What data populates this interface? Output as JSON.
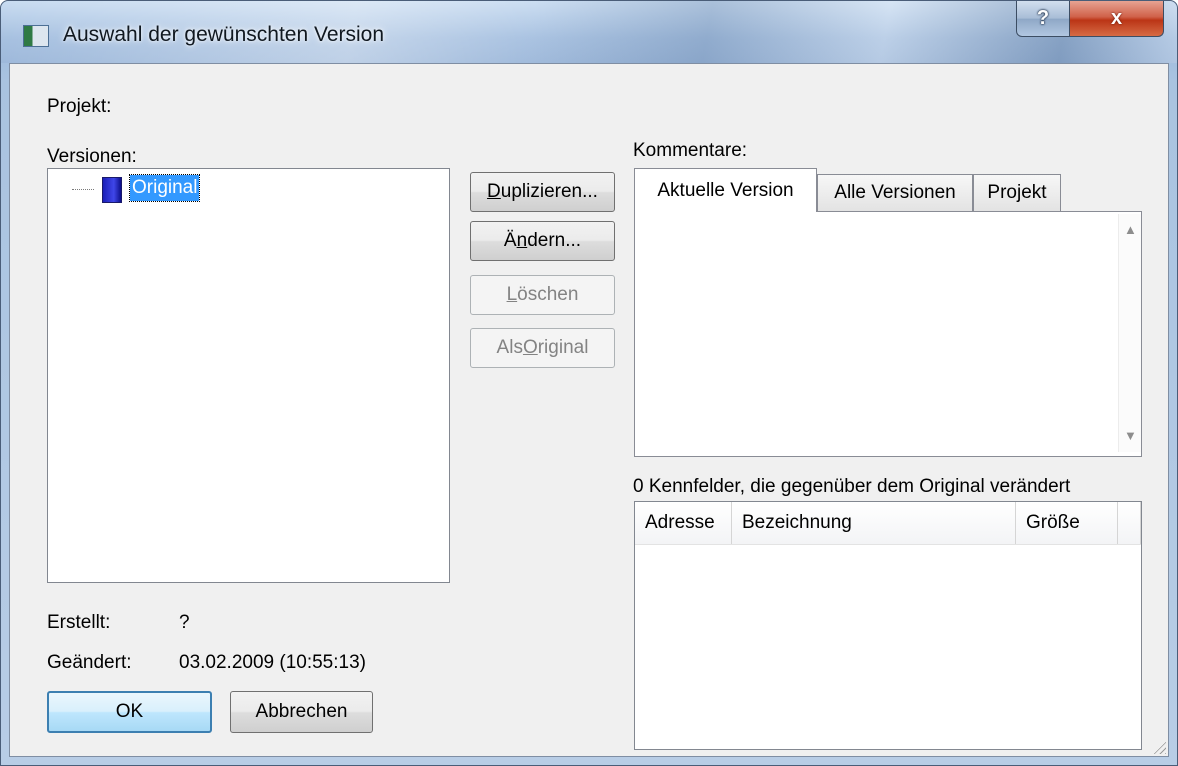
{
  "window": {
    "title": "Auswahl der gewünschten Version",
    "help_glyph": "?",
    "close_glyph": "x"
  },
  "labels": {
    "projekt": "Projekt:",
    "versionen": "Versionen:",
    "kommentare": "Kommentare:",
    "erstellt": "Erstellt:",
    "erstellt_value": "?",
    "geaendert": "Geändert:",
    "geaendert_value": "03.02.2009 (10:55:13)",
    "changed_summary": "0 Kennfelder, die gegenüber dem Original verändert"
  },
  "tree": {
    "items": [
      {
        "label": "Original",
        "selected": true
      }
    ]
  },
  "buttons": {
    "duplizieren": {
      "mnemonic": "D",
      "rest": "uplizieren...",
      "enabled": true
    },
    "aendern": {
      "pre": "Ä",
      "mnemonic": "n",
      "rest": "dern...",
      "enabled": true
    },
    "loeschen": {
      "mnemonic": "L",
      "rest": "öschen",
      "enabled": false
    },
    "als_original": {
      "pre": "Als ",
      "mnemonic": "O",
      "rest": "riginal",
      "enabled": false
    },
    "ok": "OK",
    "abbrechen": "Abbrechen"
  },
  "tabs": [
    {
      "label": "Aktuelle Version",
      "active": true
    },
    {
      "label": "Alle Versionen",
      "active": false
    },
    {
      "label": "Projekt",
      "active": false
    }
  ],
  "table": {
    "columns": [
      "Adresse",
      "Bezeichnung",
      "Größe"
    ],
    "rows": []
  },
  "colors": {
    "selection": "#3399ff",
    "disabled_text": "#838383",
    "default_button_border": "#3c7fb1"
  }
}
